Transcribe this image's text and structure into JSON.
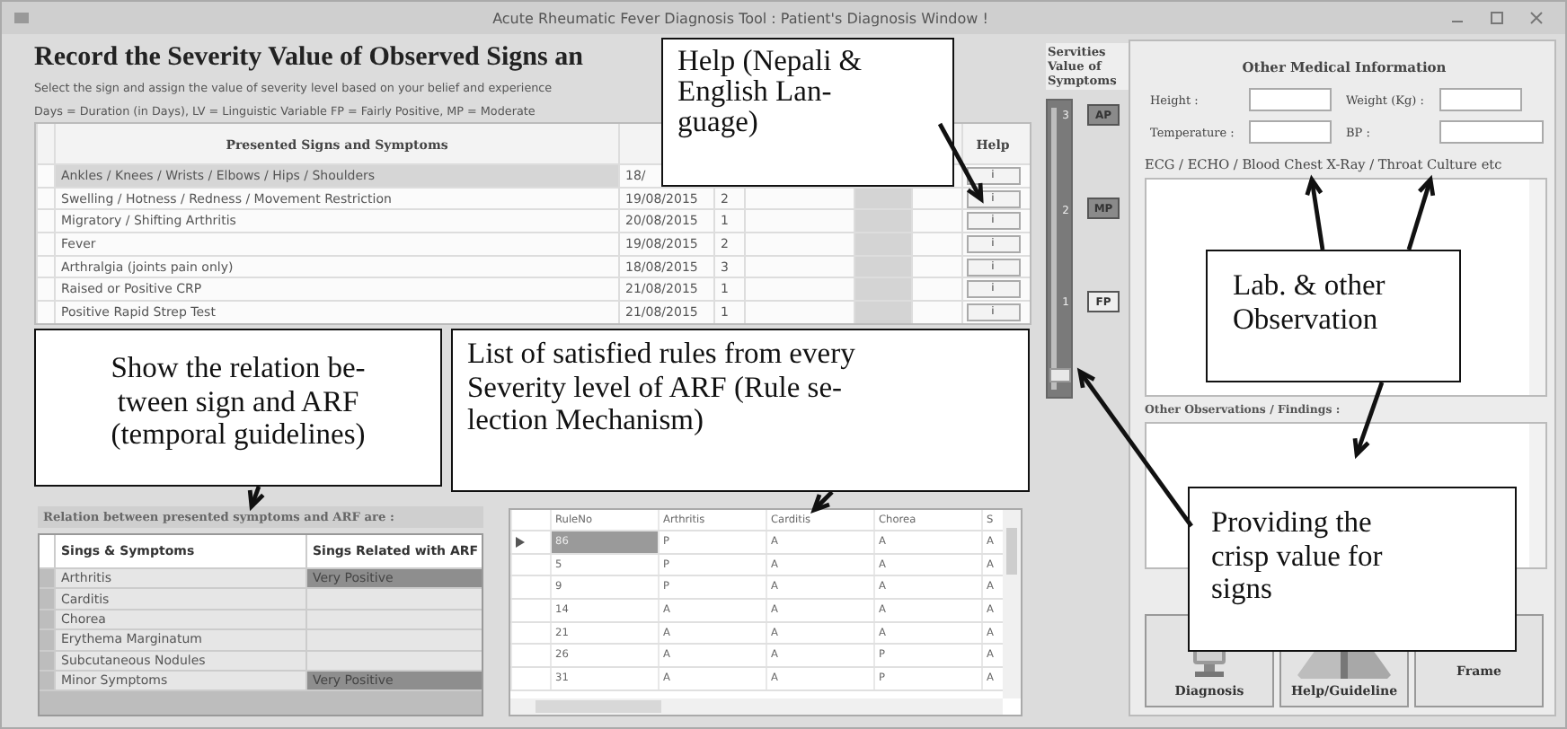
{
  "window": {
    "title": "Acute Rheumatic Fever Diagnosis Tool : Patient's Diagnosis Window !"
  },
  "record_panel": {
    "heading": "Record the Severity Value of Observed Signs an",
    "instruction": "Select the sign and assign the value of severity level based on your belief and experience",
    "legend": "Days = Duration (in Days),  LV = Linguistic Variable    FP = Fairly Positive, MP = Moderate"
  },
  "signs_table": {
    "columns": {
      "sign": "Presented Signs and Symptoms",
      "help": "Help"
    },
    "rows": [
      {
        "sign": "Ankles / Knees / Wrists / Elbows / Hips / Shoulders",
        "date": "18/",
        "help": "i",
        "selected": true
      },
      {
        "sign": "Swelling / Hotness / Redness / Movement Restriction",
        "date": "19/08/2015",
        "days": "2",
        "help": "i",
        "selected": false
      },
      {
        "sign": "Migratory / Shifting Arthritis",
        "date": "20/08/2015",
        "days": "1",
        "help": "i",
        "selected": false
      },
      {
        "sign": "Fever",
        "date": "19/08/2015",
        "days": "2",
        "help": "i",
        "selected": false
      },
      {
        "sign": "Arthralgia (joints pain only)",
        "date": "18/08/2015",
        "days": "3",
        "help": "i",
        "selected": false
      },
      {
        "sign": "Raised or Positive CRP",
        "date": "21/08/2015",
        "days": "1",
        "help": "i",
        "selected": false
      },
      {
        "sign": "Positive Rapid Strep Test",
        "date": "21/08/2015",
        "days": "1",
        "help": "i",
        "selected": false
      }
    ]
  },
  "slider": {
    "title": "Servities Value of Symptoms",
    "ticks": [
      "3",
      "2",
      "1"
    ],
    "level": 0.04,
    "buttons": [
      {
        "label": "AP",
        "highlighted": true
      },
      {
        "label": "MP",
        "highlighted": true
      },
      {
        "label": "FP",
        "highlighted": false
      }
    ]
  },
  "medical_info": {
    "heading": "Other Medical Information",
    "fields": [
      {
        "label": "Height :"
      },
      {
        "label": "Weight (Kg) :"
      },
      {
        "label": "Temperature :"
      },
      {
        "label": "BP :"
      }
    ],
    "lab_label": "ECG / ECHO  / Blood  Chest X-Ray / Throat Culture etc",
    "observations_label": "Other Observations / Findings :"
  },
  "actions": [
    {
      "label": "Diagnosis",
      "kind": "monitor"
    },
    {
      "label": "Help/Guideline",
      "kind": "book"
    },
    {
      "label": "Frame",
      "kind": "plain"
    }
  ],
  "relation": {
    "title": "Relation between presented symptoms and ARF are :",
    "columns": [
      "Sings & Symptoms",
      "Sings Related with ARF"
    ],
    "rows": [
      {
        "sign": "Arthritis",
        "value": "Very Positive",
        "highlighted": true
      },
      {
        "sign": "Carditis",
        "highlighted": false
      },
      {
        "sign": "Chorea",
        "highlighted": false
      },
      {
        "sign": "Erythema Marginatum",
        "highlighted": false
      },
      {
        "sign": "Subcutaneous Nodules",
        "highlighted": false
      },
      {
        "sign": "Minor Symptoms",
        "value": "Very Positive",
        "highlighted": true
      }
    ]
  },
  "rules": {
    "columns": [
      "RuleNo",
      "Arthritis",
      "Carditis",
      "Chorea",
      "S"
    ],
    "rows": [
      {
        "cells": [
          "86",
          "P",
          "A",
          "A",
          "A"
        ],
        "selected": true
      },
      {
        "cells": [
          "5",
          "P",
          "A",
          "A",
          "A"
        ],
        "selected": false
      },
      {
        "cells": [
          "9",
          "P",
          "A",
          "A",
          "A"
        ],
        "selected": false
      },
      {
        "cells": [
          "14",
          "A",
          "A",
          "A",
          "A"
        ],
        "selected": false
      },
      {
        "cells": [
          "21",
          "A",
          "A",
          "A",
          "A"
        ],
        "selected": false
      },
      {
        "cells": [
          "26",
          "A",
          "A",
          "P",
          "A"
        ],
        "selected": false
      },
      {
        "cells": [
          "31",
          "A",
          "A",
          "P",
          "A"
        ],
        "selected": false
      }
    ]
  },
  "annotations": [
    {
      "lines": [
        "Help (Nepali &",
        "English Lan-",
        "guage)"
      ]
    },
    {
      "lines": [
        "Show the relation be-",
        "tween sign and ARF",
        "(temporal guidelines)"
      ]
    },
    {
      "lines": [
        "List of satisfied rules from every",
        "Severity level of ARF (Rule se-",
        "lection Mechanism)"
      ]
    },
    {
      "lines": [
        "Lab. & other",
        "Observation"
      ]
    },
    {
      "lines": [
        "Providing the",
        "crisp value for",
        "signs"
      ]
    }
  ]
}
